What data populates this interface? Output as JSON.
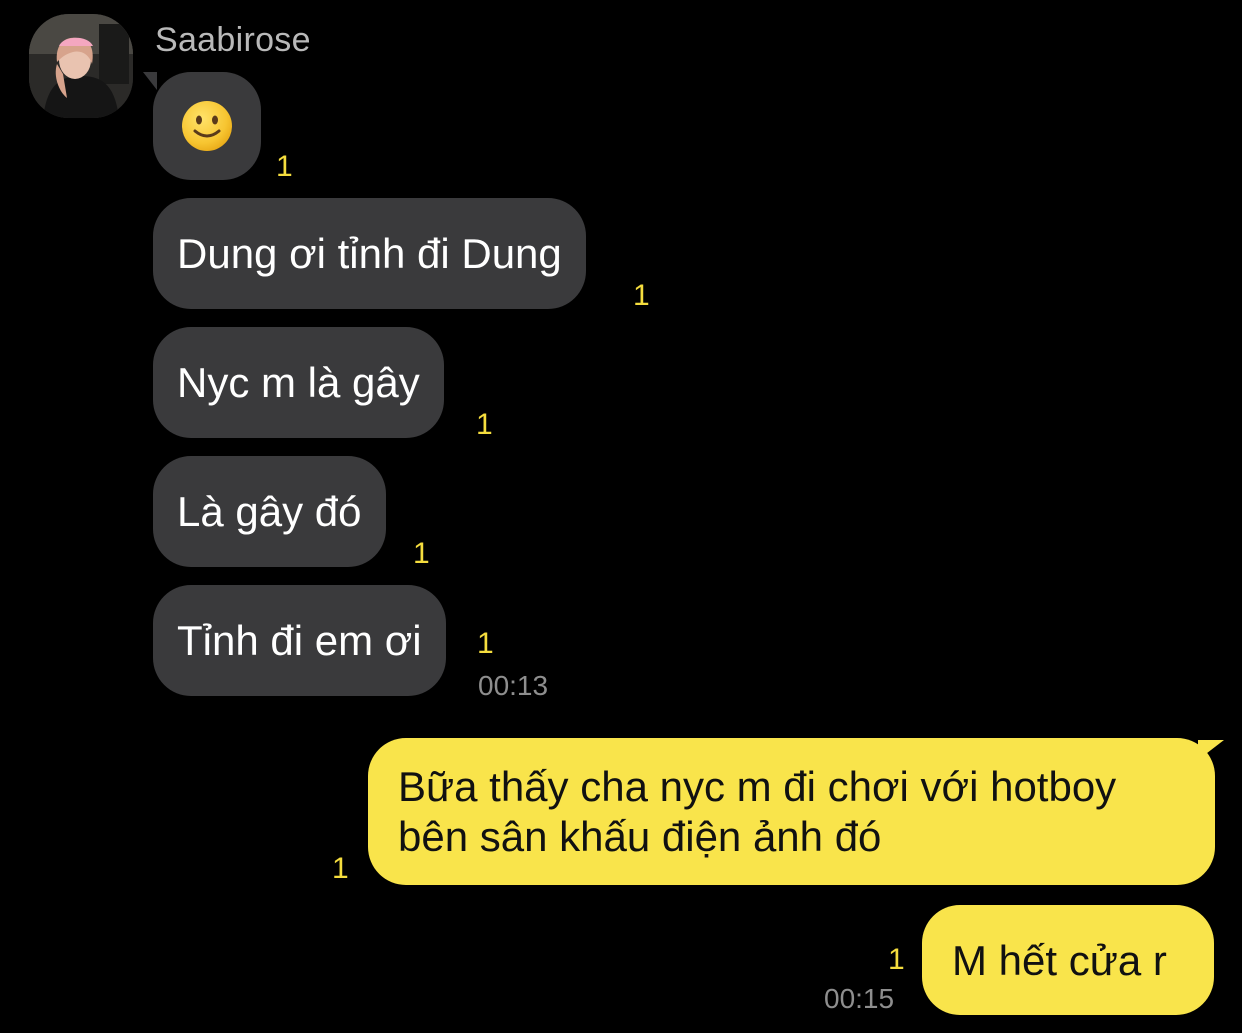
{
  "conversation": {
    "sender": {
      "name": "Saabirose",
      "avatar_icon": "profile-photo"
    },
    "incoming": [
      {
        "text": "🙂",
        "read_count": "1",
        "kind": "emoji"
      },
      {
        "text": "Dung ơi tỉnh đi Dung",
        "read_count": "1"
      },
      {
        "text": "Nyc m là gây",
        "read_count": "1"
      },
      {
        "text": "Là gây đó",
        "read_count": "1"
      },
      {
        "text": "Tỉnh đi em ơi",
        "read_count": "1",
        "time": "00:13"
      }
    ],
    "outgoing": [
      {
        "text": "Bữa thấy cha nyc m đi chơi với hotboy\nbên sân khấu điện ảnh đó",
        "read_count": "1"
      },
      {
        "text": "M hết cửa r",
        "read_count": "1",
        "time": "00:15"
      }
    ]
  },
  "colors": {
    "background": "#000000",
    "incoming_bubble": "#3a3a3c",
    "outgoing_bubble": "#f9e44b",
    "read_count": "#f5dd3e",
    "timestamp": "#8e8e8e",
    "sender_name": "#b9b9b9"
  }
}
